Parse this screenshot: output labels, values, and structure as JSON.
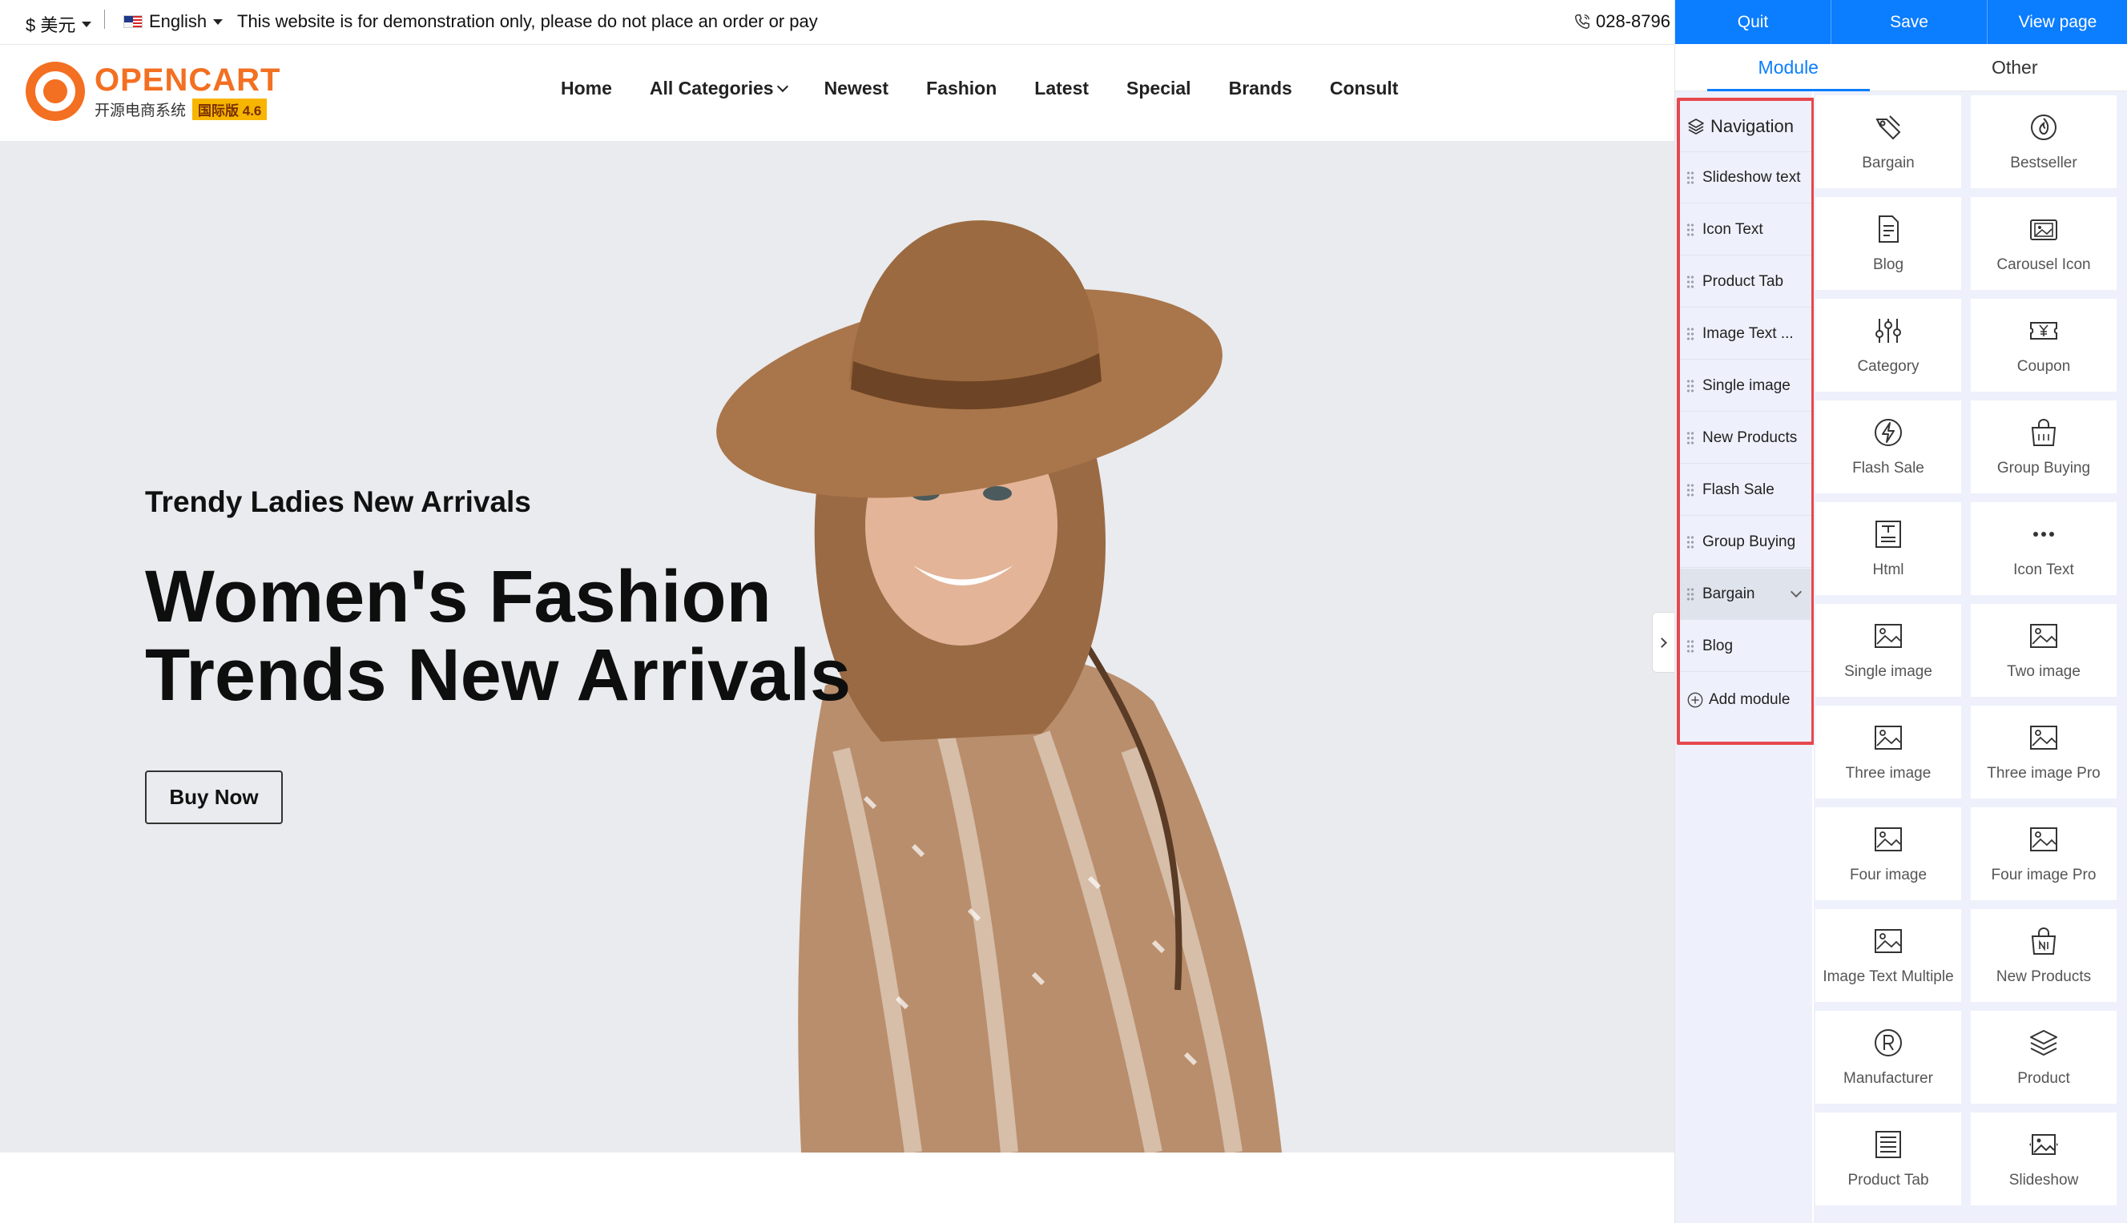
{
  "topbar": {
    "currency": "$ 美元",
    "language": "English",
    "notice": "This website is for demonstration only, please do not place an order or pay",
    "phone": "028-8796"
  },
  "logo": {
    "name": "OPENCART",
    "subtitle": "开源电商系统",
    "badge": "国际版 4.6"
  },
  "nav": {
    "items": [
      {
        "label": "Home"
      },
      {
        "label": "All Categories",
        "has_dropdown": true
      },
      {
        "label": "Newest"
      },
      {
        "label": "Fashion"
      },
      {
        "label": "Latest"
      },
      {
        "label": "Special"
      },
      {
        "label": "Brands"
      },
      {
        "label": "Consult"
      }
    ]
  },
  "hero": {
    "kicker": "Trendy Ladies New Arrivals",
    "headline_line1": "Women's Fashion",
    "headline_line2": "Trends New Arrivals",
    "button": "Buy Now"
  },
  "editor": {
    "actions": [
      "Quit",
      "Save",
      "View page"
    ],
    "tabs": [
      {
        "label": "Module",
        "active": true
      },
      {
        "label": "Other",
        "active": false
      }
    ],
    "module_list": {
      "header": "Navigation",
      "items": [
        {
          "label": "Slideshow text"
        },
        {
          "label": "Icon Text"
        },
        {
          "label": "Product Tab"
        },
        {
          "label": "Image Text ..."
        },
        {
          "label": "Single image"
        },
        {
          "label": "New Products"
        },
        {
          "label": "Flash Sale"
        },
        {
          "label": "Group Buying"
        },
        {
          "label": "Bargain",
          "expanded_toggle": true
        },
        {
          "label": "Blog"
        }
      ],
      "add_label": "Add module"
    },
    "library": [
      {
        "label": "Bargain",
        "icon": "bargain-icon"
      },
      {
        "label": "Bestseller",
        "icon": "flame-icon"
      },
      {
        "label": "Blog",
        "icon": "document-icon"
      },
      {
        "label": "Carousel Icon",
        "icon": "carousel-icon"
      },
      {
        "label": "Category",
        "icon": "sliders-icon"
      },
      {
        "label": "Coupon",
        "icon": "coupon-icon"
      },
      {
        "label": "Flash Sale",
        "icon": "lightning-icon"
      },
      {
        "label": "Group Buying",
        "icon": "shopping-bag-icon"
      },
      {
        "label": "Html",
        "icon": "html-icon"
      },
      {
        "label": "Icon Text",
        "icon": "ellipsis-icon"
      },
      {
        "label": "Single image",
        "icon": "image-icon"
      },
      {
        "label": "Two image",
        "icon": "image-icon"
      },
      {
        "label": "Three image",
        "icon": "image-icon"
      },
      {
        "label": "Three image Pro",
        "icon": "image-icon"
      },
      {
        "label": "Four image",
        "icon": "image-icon"
      },
      {
        "label": "Four image Pro",
        "icon": "image-icon"
      },
      {
        "label": "Image Text Multiple",
        "icon": "image-icon"
      },
      {
        "label": "New Products",
        "icon": "new-bag-icon"
      },
      {
        "label": "Manufacturer",
        "icon": "registered-icon"
      },
      {
        "label": "Product",
        "icon": "layers-icon"
      },
      {
        "label": "Product Tab",
        "icon": "list-doc-icon"
      },
      {
        "label": "Slideshow",
        "icon": "slideshow-icon"
      }
    ]
  },
  "colors": {
    "accent": "#0b7dff",
    "brand": "#f36f21",
    "highlight_border": "#e5484d",
    "panel_bg": "#eef1fb",
    "hero_bg": "#e9ebee"
  }
}
